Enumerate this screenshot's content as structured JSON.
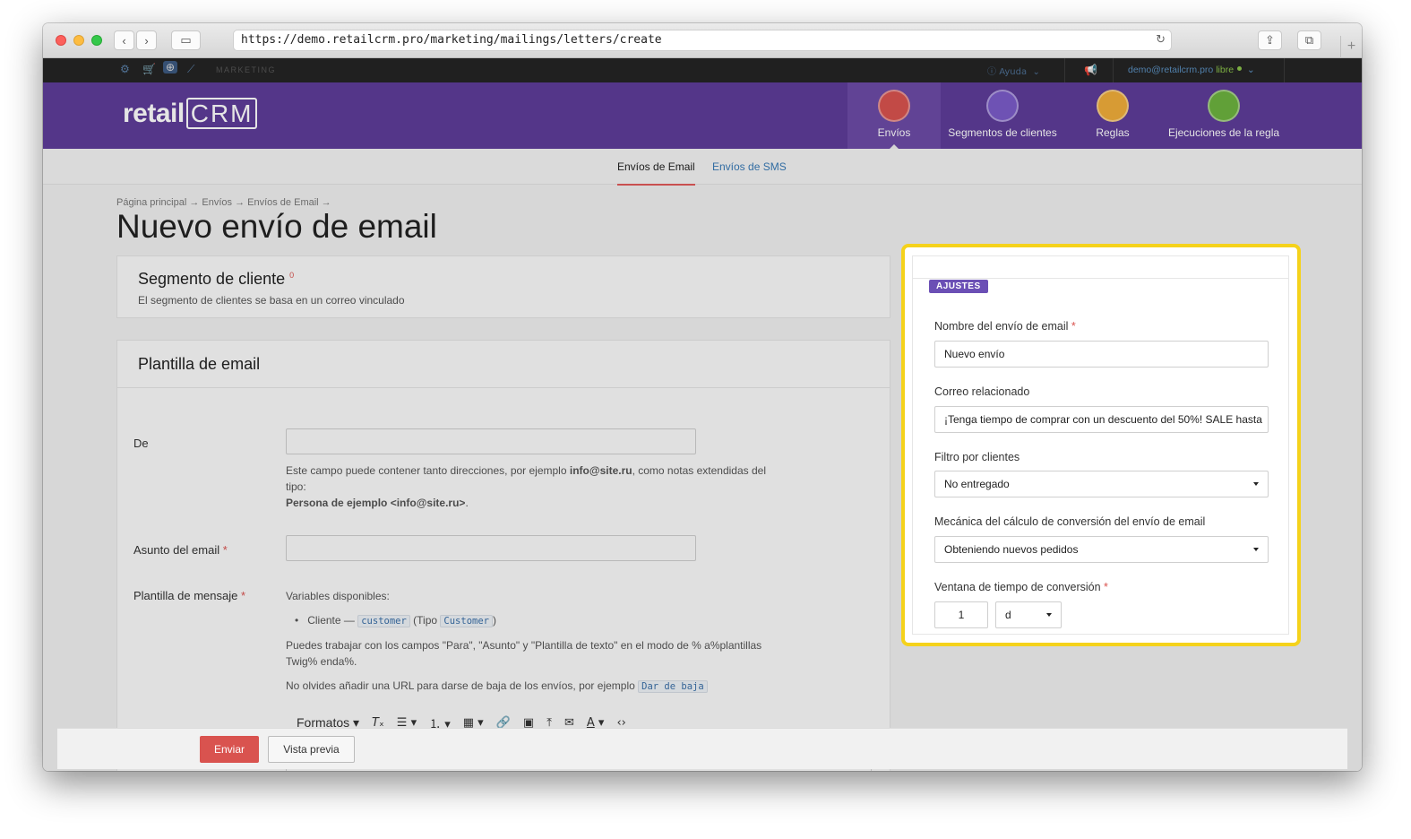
{
  "browser": {
    "url": "https://demo.retailcrm.pro/marketing/mailings/letters/create"
  },
  "topbar": {
    "section": "MARKETING",
    "help": "Ayuda",
    "user_email": "demo@retailcrm.pro",
    "plan": "libre"
  },
  "header": {
    "logo_text": "retail",
    "logo_crm": "CRM",
    "nav": [
      {
        "label": "Envíos",
        "color": "#d9534f"
      },
      {
        "label": "Segmentos de clientes",
        "color": "#7b5cc9"
      },
      {
        "label": "Reglas",
        "color": "#f0ad3a"
      },
      {
        "label": "Ejecuciones de la regla",
        "color": "#6db33f"
      }
    ]
  },
  "subtabs": {
    "email": "Envíos de Email",
    "sms": "Envíos de SMS"
  },
  "breadcrumb": "Página principal → Envíos → Envíos de Email →",
  "page_title": "Nuevo envío de email",
  "segment_card": {
    "title": "Segmento de cliente",
    "marker": "0",
    "desc": "El segmento de clientes se basa en un correo vinculado"
  },
  "template_card": {
    "title": "Plantilla de email",
    "from_label": "De",
    "from_help_1": "Este campo puede contener tanto direcciones, por ejemplo",
    "from_help_email": "info@site.ru",
    "from_help_2": ", como notas extendidas del",
    "from_help_3": "tipo:",
    "from_help_example": "Persona de ejemplo <info@site.ru>",
    "from_help_end": ".",
    "subject_label": "Asunto del email",
    "message_label": "Plantilla de mensaje",
    "vars_title": "Variables disponibles:",
    "var_item_prefix": "Cliente —",
    "var_code": "customer",
    "var_type_open": "(Tipo",
    "var_type_code": "Customer",
    "var_type_close": ")",
    "twig_help_1": "Puedes trabajar con los campos \"Para\", \"Asunto\" y \"Plantilla de texto\" en el modo de % a%plantillas",
    "twig_help_2": "Twig% enda%.",
    "unsub_help": "No olvides añadir una URL para darse de baja de los envíos, por ejemplo",
    "unsub_code": "Dar de baja",
    "formats": "Formatos"
  },
  "actions": {
    "send": "Enviar",
    "preview": "Vista previa"
  },
  "settings": {
    "badge": "AJUSTES",
    "name_label": "Nombre del envío de email",
    "name_value": "Nuevo envío",
    "related_label": "Correo relacionado",
    "related_value": "¡Tenga tiempo de comprar con un descuento del 50%! SALE hasta",
    "filter_label": "Filtro por clientes",
    "filter_value": "No entregado",
    "mechanic_label": "Mecánica del cálculo de conversión del envío de email",
    "mechanic_value": "Obteniendo nuevos pedidos",
    "window_label": "Ventana de tiempo de conversión",
    "window_value": "1",
    "window_unit": "d"
  },
  "highlight_color": "#f5d21b"
}
